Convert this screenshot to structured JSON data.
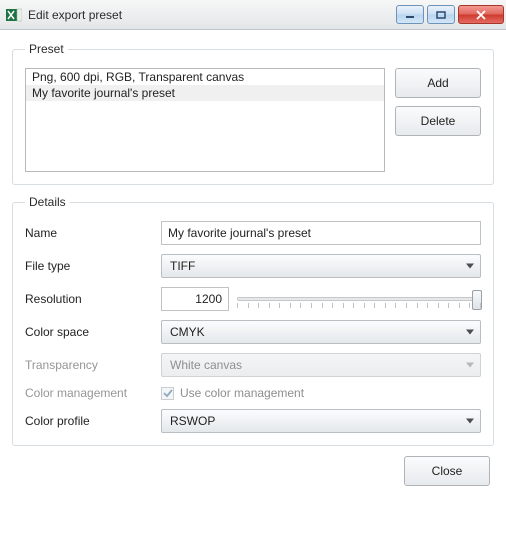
{
  "window": {
    "title": "Edit export preset"
  },
  "preset": {
    "legend": "Preset",
    "items": [
      {
        "label": "Png, 600 dpi, RGB, Transparent canvas",
        "selected": false
      },
      {
        "label": "My favorite journal's preset",
        "selected": true
      }
    ],
    "add_label": "Add",
    "delete_label": "Delete"
  },
  "details": {
    "legend": "Details",
    "name_label": "Name",
    "name_value": "My favorite journal's preset",
    "filetype_label": "File type",
    "filetype_value": "TIFF",
    "resolution_label": "Resolution",
    "resolution_value": "1200",
    "colorspace_label": "Color space",
    "colorspace_value": "CMYK",
    "transparency_label": "Transparency",
    "transparency_value": "White canvas",
    "color_management_label": "Color management",
    "use_color_management_label": "Use color management",
    "use_color_management_checked": true,
    "color_profile_label": "Color profile",
    "color_profile_value": "RSWOP"
  },
  "footer": {
    "close_label": "Close"
  }
}
